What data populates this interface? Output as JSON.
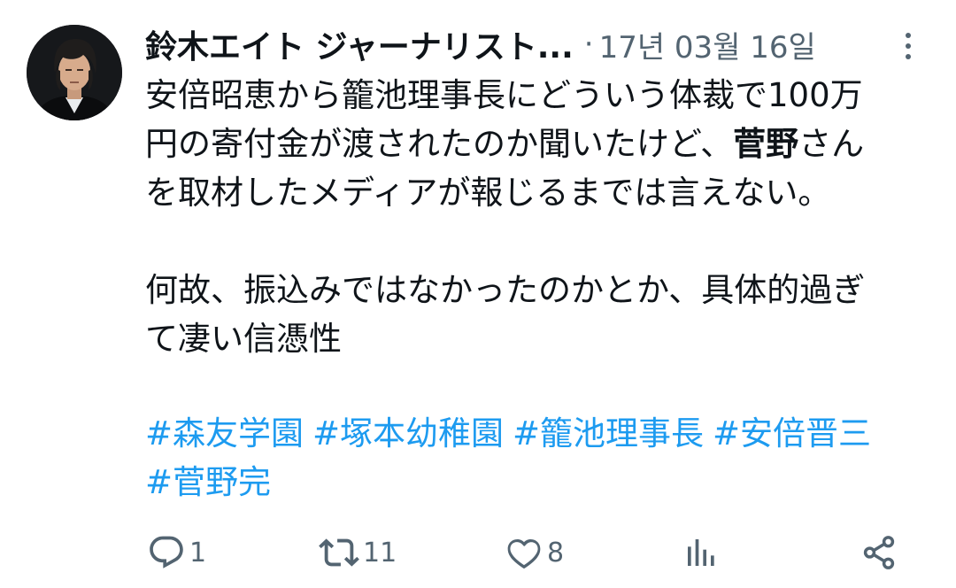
{
  "author": {
    "display_name": "鈴木エイト ジャーナリスト...",
    "separator": "·",
    "timestamp": "17년 03월 16일"
  },
  "tweet": {
    "lines": [
      {
        "text": "安倍昭恵から籠池理事長にどういう体裁で100万"
      },
      {
        "pre": "円の寄付金が渡されたのか聞いたけど、",
        "bold": "菅野",
        "post": "さん"
      },
      {
        "text": "を取材したメディアが報じるまでは言えない。"
      },
      {
        "text": ""
      },
      {
        "text": "何故、振込みではなかったのかとか、具体的過ぎ"
      },
      {
        "text": "て凄い信憑性"
      }
    ],
    "hashtags_row1": [
      "#森友学園",
      "#塚本幼稚園",
      "#籠池理事長",
      "#安倍晋三"
    ],
    "hashtags_row2": [
      "#菅野完"
    ]
  },
  "actions": {
    "reply_count": "1",
    "retweet_count": "11",
    "like_count": "8"
  },
  "icons": {
    "reply": "reply-icon",
    "retweet": "retweet-icon",
    "like": "heart-icon",
    "views": "bar-chart-icon",
    "share": "share-icon",
    "more": "more-vertical-icon"
  },
  "colors": {
    "text": "#0f1419",
    "muted": "#536471",
    "link": "#1d9bf0"
  }
}
